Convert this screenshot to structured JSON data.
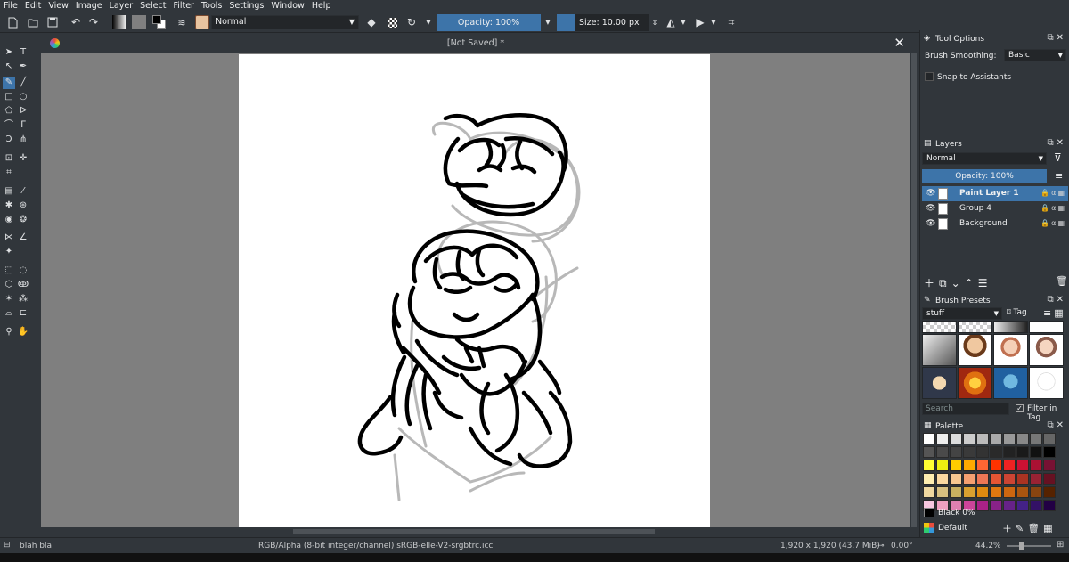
{
  "menu": [
    "File",
    "Edit",
    "View",
    "Image",
    "Layer",
    "Select",
    "Filter",
    "Tools",
    "Settings",
    "Window",
    "Help"
  ],
  "toolbar": {
    "blend_mode": "Normal",
    "opacity": "Opacity: 100%",
    "size": "Size: 10.00 px"
  },
  "document": {
    "title": "[Not Saved]  *"
  },
  "tool_options": {
    "title": "Tool Options",
    "smoothing_label": "Brush Smoothing:",
    "smoothing_value": "Basic",
    "snap_label": "Snap to Assistants"
  },
  "layers": {
    "title": "Layers",
    "blend_mode": "Normal",
    "opacity": "Opacity:  100%",
    "items": [
      {
        "name": "Paint Layer 1",
        "selected": true
      },
      {
        "name": "Group 4",
        "selected": false
      },
      {
        "name": "Background",
        "selected": false
      }
    ]
  },
  "brush_presets": {
    "title": "Brush Presets",
    "tag": "stuff",
    "tag_button": "Tag",
    "search_placeholder": "Search",
    "filter_label": "Filter in Tag"
  },
  "palette": {
    "title": "Palette",
    "current_color": "Black 0%",
    "name": "Default",
    "rows": [
      [
        "#ffffff",
        "#eeeeee",
        "#dddddd",
        "#cccccc",
        "#bbbbbb",
        "#aaaaaa",
        "#999999",
        "#888888",
        "#777777",
        "#666666"
      ],
      [
        "#555555",
        "#4a4a4a",
        "#444444",
        "#3a3a3a",
        "#333333",
        "#2a2a2a",
        "#222222",
        "#1a1a1a",
        "#111111",
        "#000000"
      ],
      [
        "#ffff33",
        "#eef011",
        "#ffcc00",
        "#ffaa00",
        "#ff6633",
        "#ff3300",
        "#ee2222",
        "#cc1133",
        "#aa1133",
        "#771133"
      ],
      [
        "#ffeeb0",
        "#fbd9a0",
        "#f8c890",
        "#f5a070",
        "#ee7755",
        "#e65533",
        "#cc4433",
        "#aa3322",
        "#992233",
        "#661122"
      ],
      [
        "#efd8a0",
        "#d8c080",
        "#c8b060",
        "#d9a030",
        "#e08a10",
        "#e07810",
        "#cc6610",
        "#aa5510",
        "#884410",
        "#552200"
      ],
      [
        "#f8c8e0",
        "#f0a0c0",
        "#e080b0",
        "#cc4499",
        "#aa2288",
        "#882288",
        "#662288",
        "#442288",
        "#331166",
        "#220044"
      ]
    ]
  },
  "status": {
    "left": "blah bla",
    "colorspace": "RGB/Alpha (8-bit integer/channel)  sRGB-elle-V2-srgbtrc.icc",
    "dimensions": "1,920 x 1,920 (43.7 MiB)",
    "rotation": "0.00°",
    "zoom": "44.2%"
  },
  "colors": {
    "bg": "#31363b",
    "accent": "#3d74a9",
    "canvas_bg": "#7f7f7f"
  },
  "icons": [
    "new-icon",
    "open-icon",
    "save-icon",
    "undo-icon",
    "redo-icon",
    "gradient-icon",
    "pattern-icon",
    "fg-bg-icon",
    "brush-settings-icon",
    "preset-icon",
    "eraser-icon",
    "alpha-lock-icon",
    "reload-icon",
    "mirror-h-icon",
    "mirror-v-icon",
    "wrap-icon"
  ]
}
